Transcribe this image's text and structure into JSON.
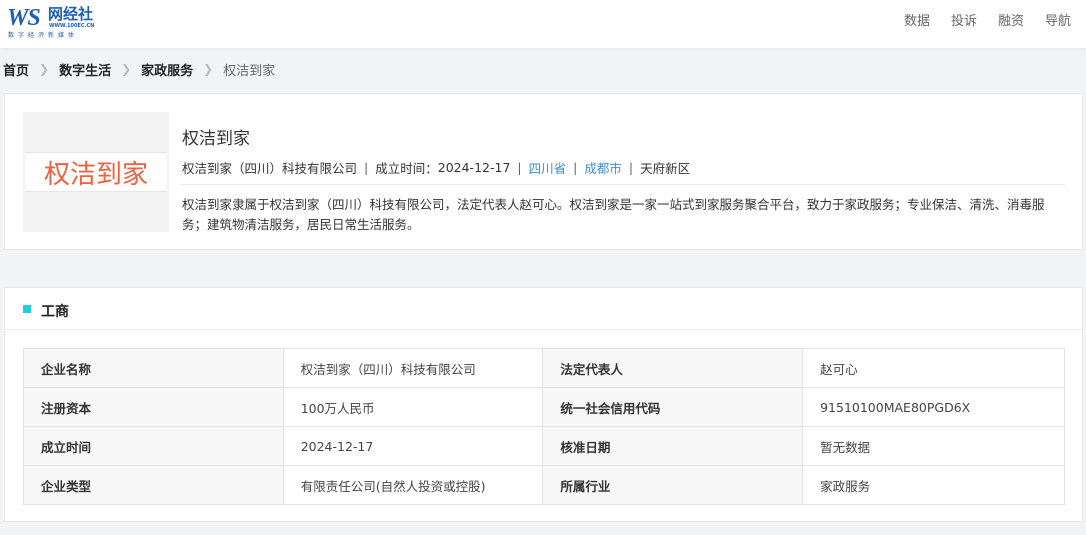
{
  "header": {
    "logo": {
      "mark": "WS",
      "name": "网经社",
      "url": "WWW.100EC.CN",
      "tagline": "数字经济新媒体"
    },
    "nav": [
      "数据",
      "投诉",
      "融资",
      "导航"
    ]
  },
  "breadcrumb": {
    "links": [
      "首页",
      "数字生活",
      "家政服务"
    ],
    "current": "权洁到家"
  },
  "company": {
    "logo_text": "权洁到家",
    "name": "权洁到家",
    "full_name": "权洁到家（四川）科技有限公司",
    "founded_label": "成立时间：",
    "founded": "2024-12-17",
    "province": "四川省",
    "city": "成都市",
    "district": "天府新区",
    "description": "权洁到家隶属于权洁到家（四川）科技有限公司，法定代表人赵可心。权洁到家是一家一站式到家服务聚合平台，致力于家政服务；专业保洁、清洗、消毒服务；建筑物清洁服务，居民日常生活服务。"
  },
  "business": {
    "title": "工商",
    "rows": [
      {
        "k1": "企业名称",
        "v1": "权洁到家（四川）科技有限公司",
        "k2": "法定代表人",
        "v2": "赵可心"
      },
      {
        "k1": "注册资本",
        "v1": "100万人民币",
        "k2": "统一社会信用代码",
        "v2": "91510100MAE80PGD6X"
      },
      {
        "k1": "成立时间",
        "v1": "2024-12-17",
        "k2": "核准日期",
        "v2": "暂无数据"
      },
      {
        "k1": "企业类型",
        "v1": "有限责任公司(自然人投资或控股)",
        "k2": "所属行业",
        "v2": "家政服务"
      }
    ]
  },
  "colors": {
    "accent": "#1ccfd8",
    "link": "#3b8fd6",
    "brand": "#1f5fb8",
    "logo_text": "#f0603f"
  }
}
